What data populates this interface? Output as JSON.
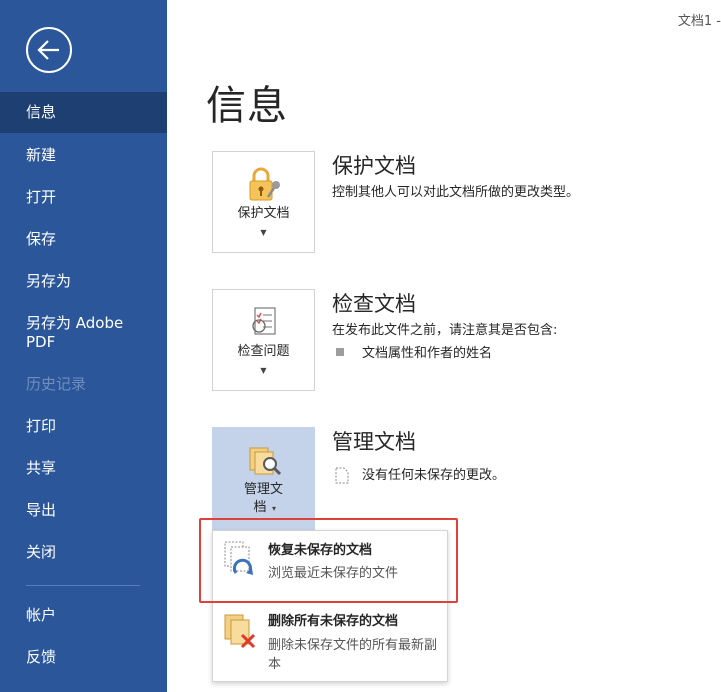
{
  "window": {
    "doc_title": "文档1 -"
  },
  "sidebar": {
    "items": [
      {
        "label": "信息",
        "active": true
      },
      {
        "label": "新建"
      },
      {
        "label": "打开"
      },
      {
        "label": "保存"
      },
      {
        "label": "另存为"
      },
      {
        "label": "另存为 Adobe PDF"
      },
      {
        "label": "历史记录",
        "disabled": true
      },
      {
        "label": "打印"
      },
      {
        "label": "共享"
      },
      {
        "label": "导出"
      },
      {
        "label": "关闭"
      },
      {
        "label": "帐户"
      },
      {
        "label": "反馈"
      }
    ]
  },
  "main": {
    "page_title": "信息",
    "protect": {
      "button_label": "保护文档",
      "title": "保护文档",
      "description": "控制其他人可以对此文档所做的更改类型。"
    },
    "inspect": {
      "button_label": "检查问题",
      "title": "检查文档",
      "description": "在发布此文件之前，请注意其是否包含:",
      "bullet": "文档属性和作者的姓名"
    },
    "manage": {
      "button_label_line1": "管理文",
      "button_label_line2": "档",
      "title": "管理文档",
      "status": "没有任何未保存的更改。"
    }
  },
  "dropdown": {
    "recover": {
      "title": "恢复未保存的文档",
      "description": "浏览最近未保存的文件"
    },
    "delete": {
      "title": "删除所有未保存的文档",
      "description": "删除未保存文件的所有最新副本"
    }
  },
  "colors": {
    "sidebar_bg": "#2b579a",
    "sidebar_active": "#1e3f71",
    "tile_active_bg": "#c5d3ea",
    "highlight": "#e0403a"
  },
  "icons": [
    "back-arrow-icon",
    "lock-key-icon",
    "inspect-checklist-icon",
    "manage-docs-icon",
    "document-icon",
    "recover-docs-icon",
    "delete-docs-icon"
  ]
}
